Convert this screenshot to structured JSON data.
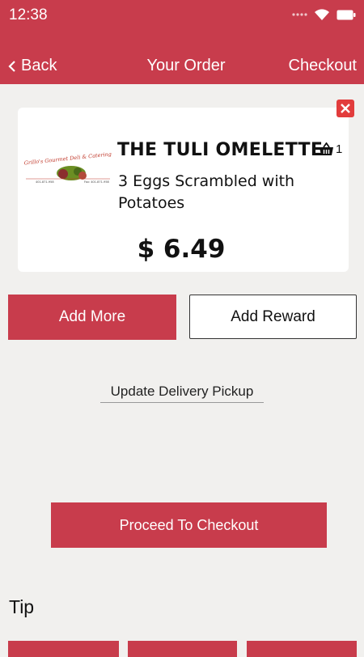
{
  "status_bar": {
    "time": "12:38"
  },
  "nav": {
    "back_label": "Back",
    "title": "Your Order",
    "checkout_label": "Checkout"
  },
  "order_item": {
    "logo_text": "Grillo's Gourmet Deli & Catering",
    "name": "THE TULI OMELETTE",
    "description": "3 Eggs Scrambled with Potatoes",
    "quantity": "1",
    "price": "$ 6.49"
  },
  "actions": {
    "add_more_label": "Add More",
    "add_reward_label": "Add Reward",
    "update_delivery_label": "Update Delivery Pickup",
    "proceed_label": "Proceed To Checkout"
  },
  "tip": {
    "title": "Tip"
  },
  "colors": {
    "accent": "#c83c4c",
    "close_red": "#e23c3c",
    "background": "#f1f0ee"
  },
  "icons": [
    "wifi-icon",
    "signal-icon",
    "battery-icon",
    "chevron-left-icon",
    "close-icon",
    "basket-icon"
  ]
}
